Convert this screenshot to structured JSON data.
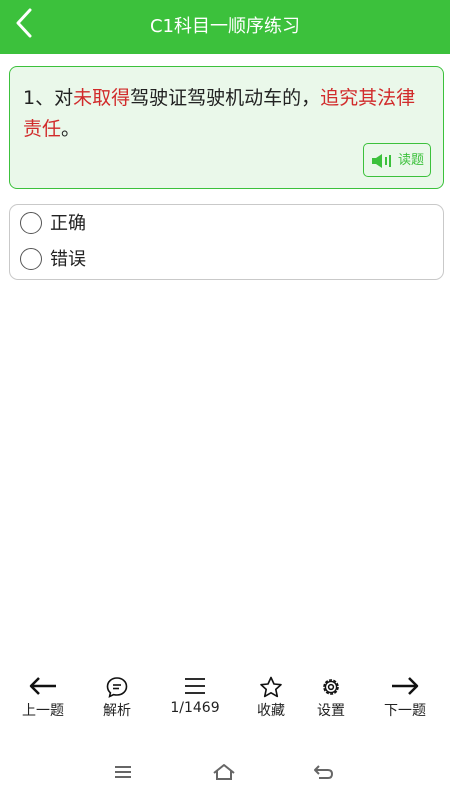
{
  "header": {
    "title": "C1科目一顺序练习"
  },
  "question": {
    "number": "1、",
    "parts": [
      {
        "text": "对",
        "hl": false
      },
      {
        "text": "未取得",
        "hl": true
      },
      {
        "text": "驾驶证驾驶机动车的，",
        "hl": false
      },
      {
        "text": "追究其法律责任",
        "hl": true
      },
      {
        "text": "。",
        "hl": false
      }
    ],
    "read_button_label": "读题"
  },
  "options": [
    {
      "label": "正确"
    },
    {
      "label": "错误"
    }
  ],
  "toolbar": {
    "prev_label": "上一题",
    "analysis_label": "解析",
    "progress": "1/1469",
    "favorite_label": "收藏",
    "settings_label": "设置",
    "next_label": "下一题"
  },
  "colors": {
    "accent": "#3cc13c",
    "highlight": "#d12b2b"
  }
}
